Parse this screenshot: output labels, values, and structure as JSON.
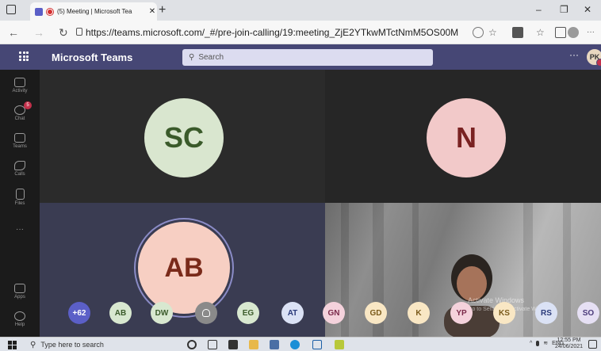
{
  "browser": {
    "tab_title": "(5) Meeting | Microsoft Tea",
    "new_tab": "+",
    "url": "https://teams.microsoft.com/_#/pre-join-calling/19:meeting_ZjE2YTkwMTctNmM5OS00MDE...",
    "win_min": "–",
    "win_max": "❐",
    "win_close": "✕"
  },
  "teams": {
    "app_title": "Microsoft Teams",
    "search_placeholder": "Search",
    "more": "···",
    "user_initials": "PK"
  },
  "rail": {
    "items": [
      {
        "label": "Activity"
      },
      {
        "label": "Chat",
        "badge": "5"
      },
      {
        "label": "Teams"
      },
      {
        "label": "Calls"
      },
      {
        "label": "Files"
      },
      {
        "label": "···"
      },
      {
        "label": "Apps"
      },
      {
        "label": "Help"
      }
    ]
  },
  "tiles": [
    {
      "initials": "SC",
      "bg": "#d9e6cf",
      "fg": "#3a5a2a"
    },
    {
      "initials": "N",
      "bg": "#f2c9c9",
      "fg": "#7a2222"
    },
    {
      "initials": "AB",
      "bg": "#f7cfc3",
      "fg": "#7a2a1a"
    }
  ],
  "video_watermark": {
    "line1": "Activate Windows",
    "line2": "Go to Settings to activate Windows."
  },
  "participants": [
    {
      "label": "+62",
      "bg": "#5b5fc7",
      "fg": "#ffffff"
    },
    {
      "label": "AB",
      "bg": "#d8e8d0",
      "fg": "#3a5a2a"
    },
    {
      "label": "DW",
      "bg": "#d8e8d0",
      "fg": "#3a5a2a"
    },
    {
      "label": "",
      "bg": "#8a8a8a",
      "fg": "#ffffff",
      "icon": "person-icon"
    },
    {
      "label": "EG",
      "bg": "#d8e8d0",
      "fg": "#3a5a2a"
    },
    {
      "label": "AT",
      "bg": "#dbe2f5",
      "fg": "#2a3a7a"
    },
    {
      "label": "GN",
      "bg": "#f4d2dc",
      "fg": "#7a2a4a"
    },
    {
      "label": "GD",
      "bg": "#f9e7c4",
      "fg": "#7a5a1a"
    },
    {
      "label": "K",
      "bg": "#f9e7c4",
      "fg": "#7a5a1a"
    },
    {
      "label": "YP",
      "bg": "#f4d2dc",
      "fg": "#7a2a4a"
    },
    {
      "label": "KS",
      "bg": "#f9e7c4",
      "fg": "#7a5a1a"
    },
    {
      "label": "RS",
      "bg": "#dbe2f5",
      "fg": "#2a3a7a"
    },
    {
      "label": "SO",
      "bg": "#e6e0f4",
      "fg": "#4a3a7a"
    }
  ],
  "taskbar": {
    "search_placeholder": "Type here to search",
    "lang": "ENG",
    "time": "12:55 PM",
    "date": "24/06/2021"
  },
  "colors": {
    "teams_header": "#464775",
    "accent": "#5b5fc7"
  }
}
